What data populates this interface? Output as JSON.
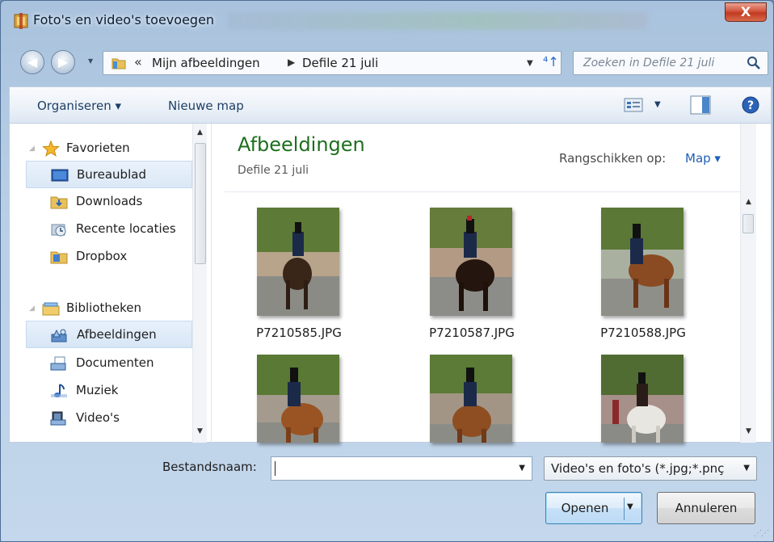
{
  "window": {
    "title": "Foto's en video's toevoegen",
    "close_label": "X"
  },
  "address": {
    "breadcrumb_chevron": "«",
    "segments": [
      "Mijn afbeeldingen",
      "Defile 21 juli"
    ],
    "separator": "▶"
  },
  "search": {
    "placeholder": "Zoeken in Defile 21 juli"
  },
  "toolbar": {
    "organise_label": "Organiseren ▾",
    "new_folder_label": "Nieuwe map"
  },
  "sidebar": {
    "items": [
      {
        "label": "Favorieten",
        "icon": "star-icon",
        "group": true
      },
      {
        "label": "Bureaublad",
        "icon": "desktop-icon",
        "selected": false
      },
      {
        "label": "Downloads",
        "icon": "downloads-icon"
      },
      {
        "label": "Recente locaties",
        "icon": "recent-places-icon"
      },
      {
        "label": "Dropbox",
        "icon": "dropbox-icon"
      },
      {
        "label": "Bibliotheken",
        "icon": "libraries-icon",
        "group": true
      },
      {
        "label": "Afbeeldingen",
        "icon": "pictures-library-icon",
        "selected": true
      },
      {
        "label": "Documenten",
        "icon": "documents-library-icon"
      },
      {
        "label": "Muziek",
        "icon": "music-library-icon"
      },
      {
        "label": "Video's",
        "icon": "video-library-icon"
      }
    ]
  },
  "content": {
    "library_title": "Afbeeldingen",
    "library_subtitle": "Defile 21 juli",
    "arrange_label": "Rangschikken op:",
    "arrange_value": "Map ▾",
    "files": [
      {
        "name": "P7210585.JPG"
      },
      {
        "name": "P7210587.JPG"
      },
      {
        "name": "P7210588.JPG"
      },
      {
        "name": ""
      },
      {
        "name": ""
      },
      {
        "name": ""
      }
    ]
  },
  "footer": {
    "filename_label": "Bestandsnaam:",
    "filename_value": "",
    "filetype_value": "Video's en foto's (*.jpg;*.pnç",
    "open_label": "Openen",
    "cancel_label": "Annuleren"
  },
  "colors": {
    "library_title": "#1e6e1e",
    "link_blue": "#1f5fb6",
    "close_red": "#c13a20"
  }
}
